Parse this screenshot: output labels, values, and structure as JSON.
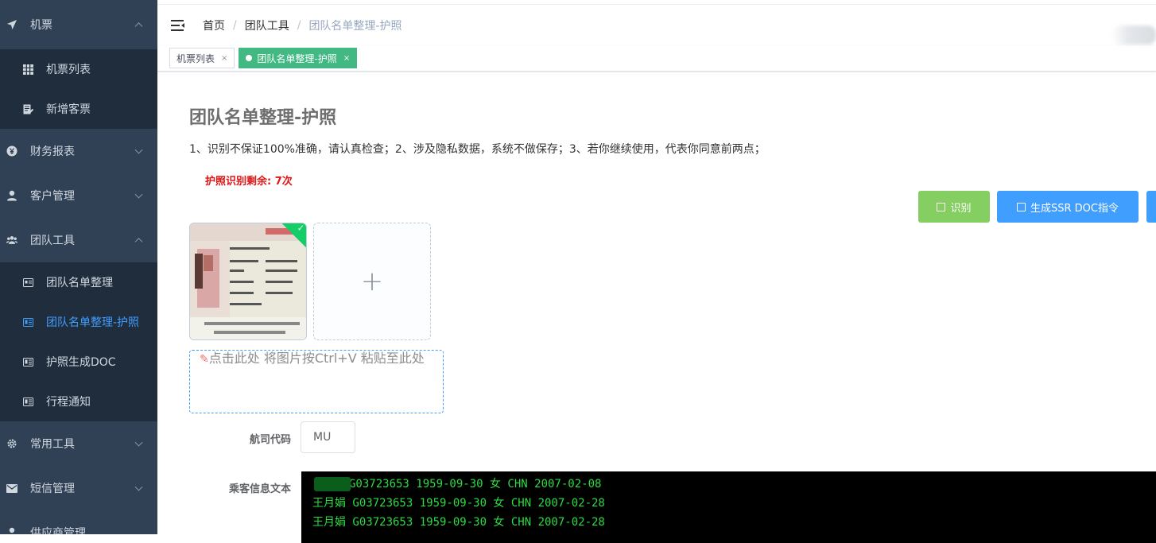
{
  "sidebar": {
    "groups": [
      {
        "label": "机票",
        "icon": "paper-plane-icon",
        "expanded": true,
        "items": [
          {
            "label": "机票列表",
            "icon": "grid-icon"
          },
          {
            "label": "新增客票",
            "icon": "edit-doc-icon"
          }
        ]
      },
      {
        "label": "财务报表",
        "icon": "yen-circle-icon",
        "expanded": false
      },
      {
        "label": "客户管理",
        "icon": "user-icon",
        "expanded": false
      },
      {
        "label": "团队工具",
        "icon": "group-icon",
        "expanded": true,
        "items": [
          {
            "label": "团队名单整理",
            "icon": "id-card-icon"
          },
          {
            "label": "团队名单整理-护照",
            "icon": "passport-icon",
            "active": true
          },
          {
            "label": "护照生成DOC",
            "icon": "passport-icon"
          },
          {
            "label": "行程通知",
            "icon": "passport-icon"
          }
        ]
      },
      {
        "label": "常用工具",
        "icon": "gear-icon",
        "expanded": false
      },
      {
        "label": "短信管理",
        "icon": "envelope-icon",
        "expanded": false
      },
      {
        "label": "供应商管理",
        "icon": "user-icon",
        "expanded": false
      }
    ]
  },
  "header": {
    "breadcrumb": [
      "首页",
      "团队工具",
      "团队名单整理-护照"
    ],
    "separator": "/"
  },
  "tabs": [
    {
      "label": "机票列表",
      "close": "×",
      "active": false
    },
    {
      "label": "团队名单整理-护照",
      "close": "×",
      "active": true
    }
  ],
  "main": {
    "title": "团队名单整理-护照",
    "notice": "1、识别不保证100%准确，请认真检查；2、涉及隐私数据，系统不做保存；3、若你继续使用，代表你同意前两点；",
    "remaining": "护照识别剩余: 7次",
    "buttons": {
      "recognize": "识别",
      "ssr_doc": "生成SSR DOC指令"
    },
    "upload": {
      "plus": "+",
      "success_mark": "✓"
    },
    "paste_hint": "点击此处 将图片按Ctrl+V 粘贴至此处",
    "airline_label": "航司代码",
    "airline_value": "MU",
    "passenger_label": "乘客信息文本",
    "passenger_lines": [
      "G03723653 1959-09-30 女 CHN 2007-02-08",
      "王月娟 G03723653 1959-09-30 女 CHN 2007-02-28",
      "王月娟 G03723653 1959-09-30 女 CHN 2007-02-28"
    ]
  },
  "colors": {
    "sidebar_bg": "#304156",
    "submenu_bg": "#1f2d3d",
    "active_link": "#409eff",
    "tag_active": "#42b983",
    "btn_success": "#85ce61",
    "btn_primary": "#409eff",
    "warning_text": "#e01515",
    "terminal_text": "#2bdc41"
  }
}
